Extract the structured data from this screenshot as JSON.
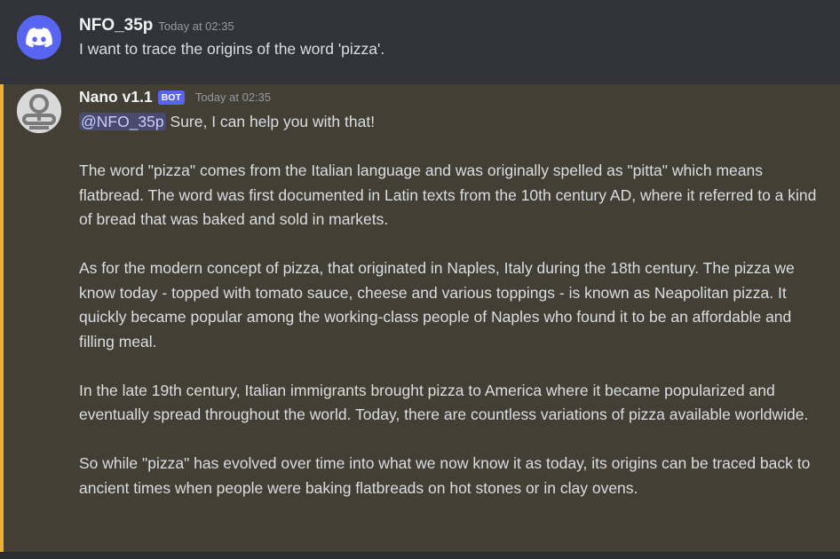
{
  "messages": [
    {
      "author": "NFO_35p",
      "timestamp": "Today at 02:35",
      "avatar_icon": "discord-logo-icon",
      "text": "I want to trace the origins of the word 'pizza'."
    },
    {
      "author": "Nano v1.1",
      "badge": "BOT",
      "timestamp": "Today at 02:35",
      "avatar_icon": "robot-avatar-icon",
      "mention": "@NFO_35p",
      "first_line": "Sure, I can help you with that!",
      "paragraphs": [
        "The word \"pizza\" comes from the Italian language and was originally spelled as \"pitta\" which means flatbread. The word was first documented in Latin texts from the 10th century AD, where it referred to a kind of bread that was baked and sold in markets.",
        "As for the modern concept of pizza, that originated in Naples, Italy during the 18th century. The pizza we know today - topped with tomato sauce, cheese and various toppings - is known as Neapolitan pizza. It quickly became popular among the working-class people of Naples who found it to be an affordable and filling meal.",
        "In the late 19th century, Italian immigrants brought pizza to America where it became popularized and eventually spread throughout the world. Today, there are countless variations of pizza available worldwide.",
        "So while \"pizza\" has evolved over time into what we now know it as today, its origins can be traced back to ancient times when people were baking flatbreads on hot stones or in clay ovens."
      ]
    }
  ],
  "colors": {
    "background": "#313338",
    "mention_highlight": "#433f35",
    "mention_bar": "#f0b132",
    "blurple": "#5865f2"
  }
}
